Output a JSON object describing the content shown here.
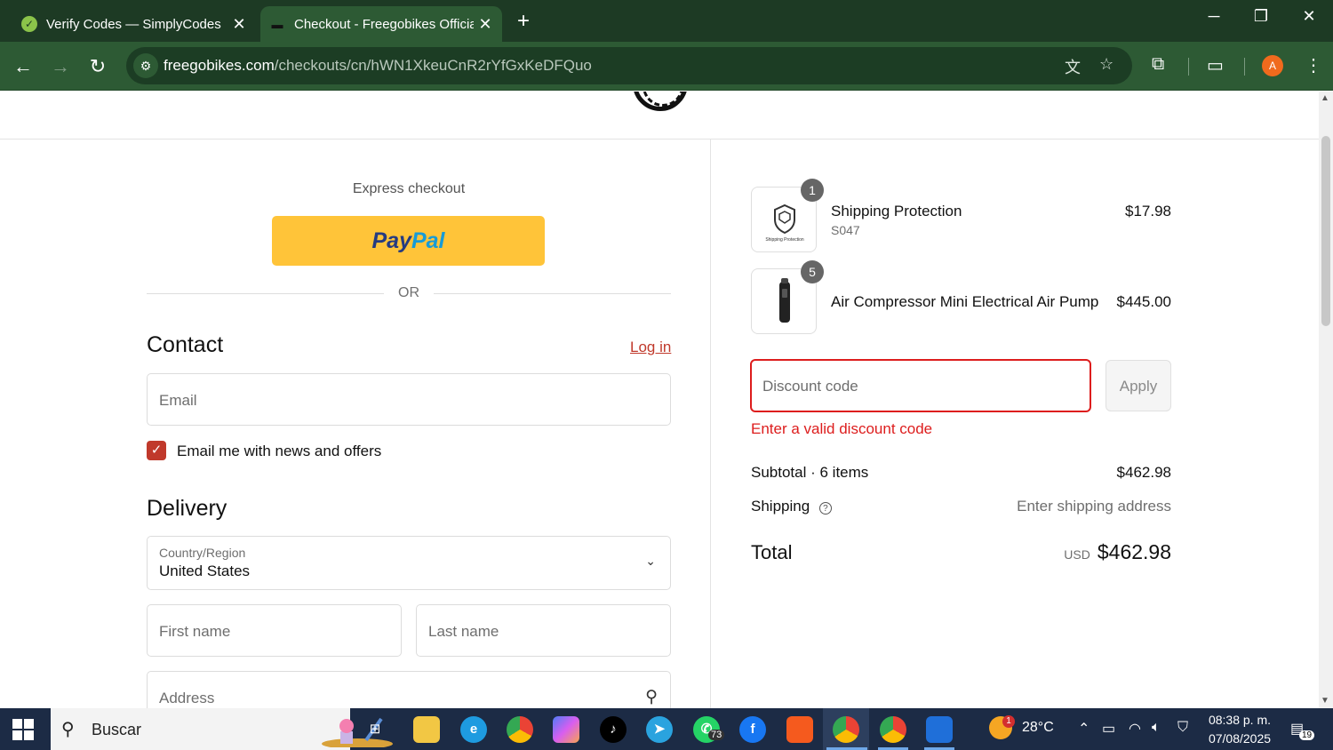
{
  "browser": {
    "tabs": [
      {
        "title": "Verify Codes — SimplyCodes",
        "active": false
      },
      {
        "title": "Checkout - Freegobikes Official",
        "active": true
      }
    ],
    "url_host": "freegobikes.com",
    "url_path": "/checkouts/cn/hWN1XkeuCnR2rYfGxKeDFQuo",
    "profile_initial": "A"
  },
  "checkout": {
    "express_label": "Express checkout",
    "paypal_a": "Pay",
    "paypal_b": "Pal",
    "or_label": "OR",
    "contact_title": "Contact",
    "login_link": "Log in",
    "email_placeholder": "Email",
    "news_checkbox_label": "Email me with news and offers",
    "news_checked": true,
    "delivery_title": "Delivery",
    "country_label": "Country/Region",
    "country_value": "United States",
    "first_name_placeholder": "First name",
    "last_name_placeholder": "Last name",
    "address_placeholder": "Address"
  },
  "summary": {
    "items": [
      {
        "name": "Shipping Protection",
        "sku": "S047",
        "price": "$17.98",
        "qty": "1",
        "thumb_caption": "Shipping Protection"
      },
      {
        "name": "Air Compressor Mini Electrical Air Pump",
        "sku": "",
        "price": "$445.00",
        "qty": "5"
      }
    ],
    "discount_placeholder": "Discount code",
    "apply_label": "Apply",
    "discount_error": "Enter a valid discount code",
    "subtotal_label": "Subtotal · 6 items",
    "subtotal_value": "$462.98",
    "shipping_label": "Shipping",
    "shipping_value": "Enter shipping address",
    "total_label": "Total",
    "total_currency": "USD",
    "total_value": "$462.98"
  },
  "taskbar": {
    "search_label": "Buscar",
    "whatsapp_badge": "73",
    "weather_badge": "1",
    "temperature": "28°C",
    "time": "08:38 p. m.",
    "date": "07/08/2025",
    "notifications": "19"
  },
  "colors": {
    "accent": "#c0392b",
    "error": "#dd1d1d",
    "paypal_yellow": "#ffc439",
    "chrome_dark": "#1d3a24",
    "chrome_toolbar": "#2d5a34"
  }
}
